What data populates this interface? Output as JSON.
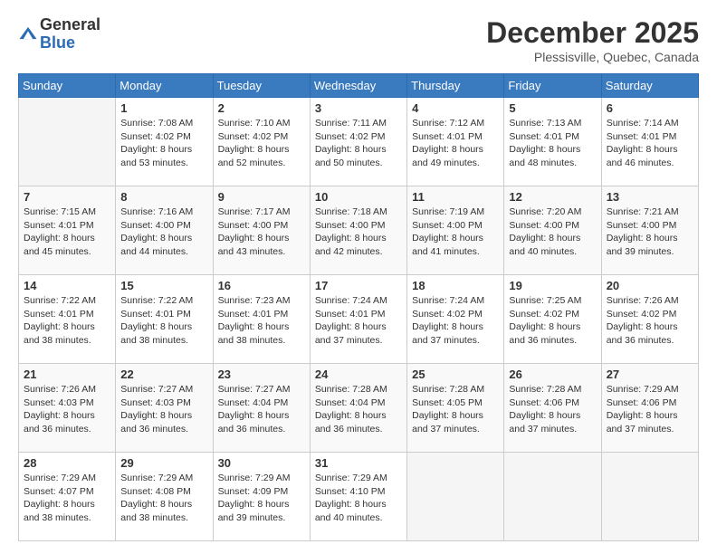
{
  "logo": {
    "general": "General",
    "blue": "Blue"
  },
  "title": {
    "month": "December 2025",
    "location": "Plessisville, Quebec, Canada"
  },
  "weekdays": [
    "Sunday",
    "Monday",
    "Tuesday",
    "Wednesday",
    "Thursday",
    "Friday",
    "Saturday"
  ],
  "weeks": [
    [
      {
        "day": "",
        "info": ""
      },
      {
        "day": "1",
        "info": "Sunrise: 7:08 AM\nSunset: 4:02 PM\nDaylight: 8 hours\nand 53 minutes."
      },
      {
        "day": "2",
        "info": "Sunrise: 7:10 AM\nSunset: 4:02 PM\nDaylight: 8 hours\nand 52 minutes."
      },
      {
        "day": "3",
        "info": "Sunrise: 7:11 AM\nSunset: 4:02 PM\nDaylight: 8 hours\nand 50 minutes."
      },
      {
        "day": "4",
        "info": "Sunrise: 7:12 AM\nSunset: 4:01 PM\nDaylight: 8 hours\nand 49 minutes."
      },
      {
        "day": "5",
        "info": "Sunrise: 7:13 AM\nSunset: 4:01 PM\nDaylight: 8 hours\nand 48 minutes."
      },
      {
        "day": "6",
        "info": "Sunrise: 7:14 AM\nSunset: 4:01 PM\nDaylight: 8 hours\nand 46 minutes."
      }
    ],
    [
      {
        "day": "7",
        "info": "Sunrise: 7:15 AM\nSunset: 4:01 PM\nDaylight: 8 hours\nand 45 minutes."
      },
      {
        "day": "8",
        "info": "Sunrise: 7:16 AM\nSunset: 4:00 PM\nDaylight: 8 hours\nand 44 minutes."
      },
      {
        "day": "9",
        "info": "Sunrise: 7:17 AM\nSunset: 4:00 PM\nDaylight: 8 hours\nand 43 minutes."
      },
      {
        "day": "10",
        "info": "Sunrise: 7:18 AM\nSunset: 4:00 PM\nDaylight: 8 hours\nand 42 minutes."
      },
      {
        "day": "11",
        "info": "Sunrise: 7:19 AM\nSunset: 4:00 PM\nDaylight: 8 hours\nand 41 minutes."
      },
      {
        "day": "12",
        "info": "Sunrise: 7:20 AM\nSunset: 4:00 PM\nDaylight: 8 hours\nand 40 minutes."
      },
      {
        "day": "13",
        "info": "Sunrise: 7:21 AM\nSunset: 4:00 PM\nDaylight: 8 hours\nand 39 minutes."
      }
    ],
    [
      {
        "day": "14",
        "info": "Sunrise: 7:22 AM\nSunset: 4:01 PM\nDaylight: 8 hours\nand 38 minutes."
      },
      {
        "day": "15",
        "info": "Sunrise: 7:22 AM\nSunset: 4:01 PM\nDaylight: 8 hours\nand 38 minutes."
      },
      {
        "day": "16",
        "info": "Sunrise: 7:23 AM\nSunset: 4:01 PM\nDaylight: 8 hours\nand 38 minutes."
      },
      {
        "day": "17",
        "info": "Sunrise: 7:24 AM\nSunset: 4:01 PM\nDaylight: 8 hours\nand 37 minutes."
      },
      {
        "day": "18",
        "info": "Sunrise: 7:24 AM\nSunset: 4:02 PM\nDaylight: 8 hours\nand 37 minutes."
      },
      {
        "day": "19",
        "info": "Sunrise: 7:25 AM\nSunset: 4:02 PM\nDaylight: 8 hours\nand 36 minutes."
      },
      {
        "day": "20",
        "info": "Sunrise: 7:26 AM\nSunset: 4:02 PM\nDaylight: 8 hours\nand 36 minutes."
      }
    ],
    [
      {
        "day": "21",
        "info": "Sunrise: 7:26 AM\nSunset: 4:03 PM\nDaylight: 8 hours\nand 36 minutes."
      },
      {
        "day": "22",
        "info": "Sunrise: 7:27 AM\nSunset: 4:03 PM\nDaylight: 8 hours\nand 36 minutes."
      },
      {
        "day": "23",
        "info": "Sunrise: 7:27 AM\nSunset: 4:04 PM\nDaylight: 8 hours\nand 36 minutes."
      },
      {
        "day": "24",
        "info": "Sunrise: 7:28 AM\nSunset: 4:04 PM\nDaylight: 8 hours\nand 36 minutes."
      },
      {
        "day": "25",
        "info": "Sunrise: 7:28 AM\nSunset: 4:05 PM\nDaylight: 8 hours\nand 37 minutes."
      },
      {
        "day": "26",
        "info": "Sunrise: 7:28 AM\nSunset: 4:06 PM\nDaylight: 8 hours\nand 37 minutes."
      },
      {
        "day": "27",
        "info": "Sunrise: 7:29 AM\nSunset: 4:06 PM\nDaylight: 8 hours\nand 37 minutes."
      }
    ],
    [
      {
        "day": "28",
        "info": "Sunrise: 7:29 AM\nSunset: 4:07 PM\nDaylight: 8 hours\nand 38 minutes."
      },
      {
        "day": "29",
        "info": "Sunrise: 7:29 AM\nSunset: 4:08 PM\nDaylight: 8 hours\nand 38 minutes."
      },
      {
        "day": "30",
        "info": "Sunrise: 7:29 AM\nSunset: 4:09 PM\nDaylight: 8 hours\nand 39 minutes."
      },
      {
        "day": "31",
        "info": "Sunrise: 7:29 AM\nSunset: 4:10 PM\nDaylight: 8 hours\nand 40 minutes."
      },
      {
        "day": "",
        "info": ""
      },
      {
        "day": "",
        "info": ""
      },
      {
        "day": "",
        "info": ""
      }
    ]
  ]
}
